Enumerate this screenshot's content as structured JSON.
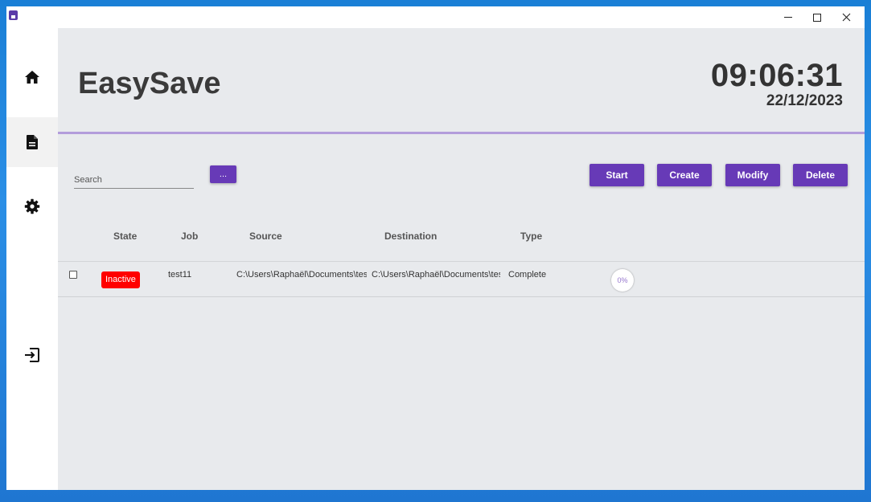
{
  "window": {
    "controls": {
      "minimize": "–",
      "maximize": "□",
      "close": "✕"
    }
  },
  "sidebar": {
    "items": [
      {
        "icon": "home-icon",
        "active": false
      },
      {
        "icon": "document-icon",
        "active": true
      },
      {
        "icon": "gear-icon",
        "active": false
      },
      {
        "icon": "exit-icon",
        "active": false
      }
    ]
  },
  "header": {
    "title": "EasySave",
    "time": "09:06:31",
    "date": "22/12/2023"
  },
  "toolbar": {
    "search_placeholder": "Search",
    "search_button_label": "...",
    "start_label": "Start",
    "create_label": "Create",
    "modify_label": "Modify",
    "delete_label": "Delete"
  },
  "table": {
    "columns": [
      "State",
      "Job",
      "Source",
      "Destination",
      "Type"
    ],
    "rows": [
      {
        "checked": false,
        "state": "Inactive",
        "job": "test11",
        "source": "C:\\Users\\Raphaël\\Documents\\tes",
        "destination": "C:\\Users\\Raphaël\\Documents\\tes",
        "type": "Complete",
        "progress": "0%"
      }
    ]
  },
  "colors": {
    "accent": "#673ab7",
    "divider": "#b39ddb",
    "inactive": "#ff0000",
    "background": "#e8eaed"
  }
}
